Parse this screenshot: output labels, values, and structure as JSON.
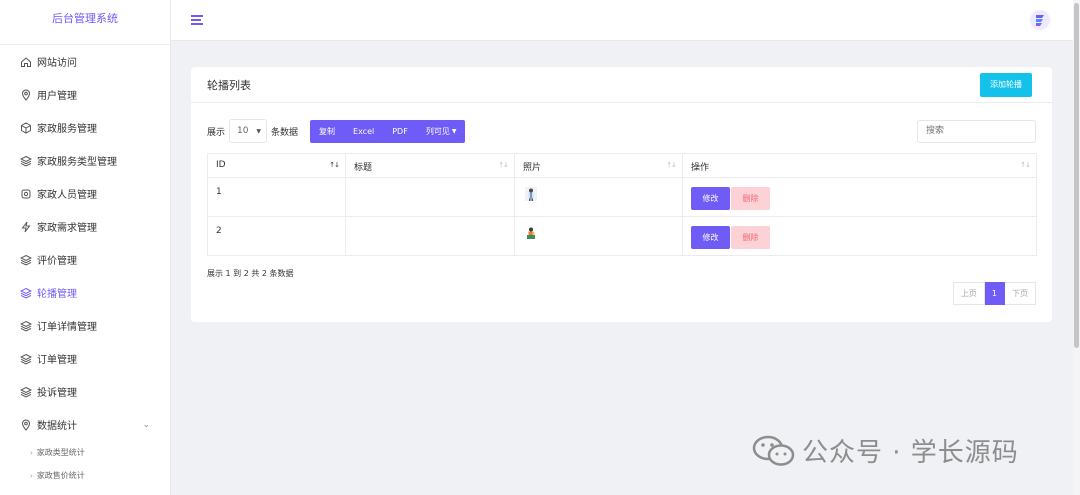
{
  "app": {
    "title": "后台管理系统"
  },
  "sidebar": {
    "items": [
      {
        "label": "网站访问",
        "icon": "home-icon"
      },
      {
        "label": "用户管理",
        "icon": "location-pin-icon"
      },
      {
        "label": "家政服务管理",
        "icon": "cube-icon"
      },
      {
        "label": "家政服务类型管理",
        "icon": "layers-icon"
      },
      {
        "label": "家政人员管理",
        "icon": "settings-icon"
      },
      {
        "label": "家政需求管理",
        "icon": "lightning-icon"
      },
      {
        "label": "评价管理",
        "icon": "layers-icon"
      },
      {
        "label": "轮播管理",
        "icon": "layers-icon",
        "active": true
      },
      {
        "label": "订单详情管理",
        "icon": "layers-icon"
      },
      {
        "label": "订单管理",
        "icon": "layers-icon"
      },
      {
        "label": "投诉管理",
        "icon": "layers-icon"
      },
      {
        "label": "数据统计",
        "icon": "location-pin-icon",
        "expanded": true
      }
    ],
    "subitems": [
      {
        "label": "家政类型统计"
      },
      {
        "label": "家政售价统计"
      }
    ]
  },
  "card": {
    "title": "轮播列表",
    "add_button": "添加轮播"
  },
  "toolbar": {
    "show_label": "展示",
    "page_length": "10",
    "entries_label": "条数据",
    "buttons": [
      "复制",
      "Excel",
      "PDF",
      "列可见"
    ],
    "search_placeholder": "搜索"
  },
  "table": {
    "columns": [
      "ID",
      "标题",
      "照片",
      "操作"
    ],
    "rows": [
      {
        "id": "1",
        "title": "",
        "photo": "person-thumbnail"
      },
      {
        "id": "2",
        "title": "",
        "photo": "person-thumbnail"
      }
    ],
    "edit_label": "修改",
    "delete_label": "删除"
  },
  "footer": {
    "info": "展示 1 到 2 共 2 条数据",
    "prev": "上页",
    "current_page": "1",
    "next": "下页"
  },
  "watermark": {
    "text": "公众号 · 学长源码"
  },
  "colors": {
    "accent": "#6f5bf5",
    "add_button": "#14c1ea",
    "delete_bg": "#fdd2d7",
    "delete_text": "#f56877"
  }
}
